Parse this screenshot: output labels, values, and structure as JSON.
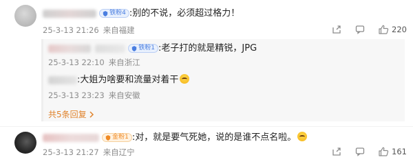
{
  "colors": {
    "badge_blue": "#4a7ee0",
    "badge_orange": "#f08a24",
    "more_link": "#e0822a",
    "meta_text": "#8c8c8c"
  },
  "comments": [
    {
      "author_badge": "铁粉4",
      "badge_color": "blue",
      "text": ":别的不说，必须超过格力！",
      "date": "25-3-13 21:26",
      "location": "来自福建",
      "like_count": "220",
      "replies": [
        {
          "author_badge": "铁粉1",
          "text": ":老子打的就是精锐，JPG",
          "date": "25-3-13 22:10",
          "location": "来自浙江"
        },
        {
          "author_badge": "",
          "text": ":大姐为啥要和流量对着干",
          "date": "25-3-13 23:23",
          "location": "来自安徽",
          "emoji": "smile-emoji"
        }
      ],
      "more_replies_label": "共5条回复",
      "more_replies_icon": "chevron-right-icon"
    },
    {
      "author_badge": "金粉1",
      "badge_color": "orange",
      "text": ":对，就是要气死她，说的是谁不点名啦。",
      "emoji": "smile-emoji",
      "date": "25-3-13 21:27",
      "location": "来自辽宁",
      "like_count": "161"
    }
  ],
  "action_icons": [
    "share-icon",
    "comment-icon",
    "like-icon"
  ]
}
